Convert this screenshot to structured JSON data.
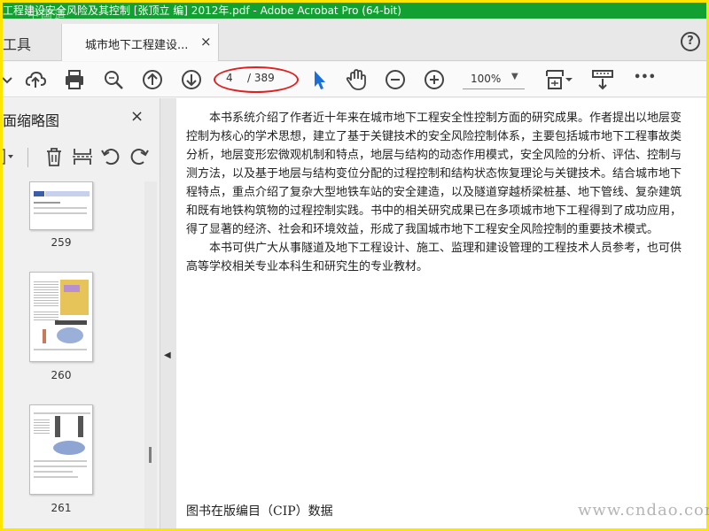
{
  "window": {
    "title": "工程建设安全风险及其控制 [张顶立 编] 2012年.pdf - Adobe Acrobat Pro (64-bit)",
    "watermark_top": "中国道"
  },
  "tabs": {
    "tools_label": "工具",
    "doc_label": "城市地下工程建设...",
    "close_glyph": "×"
  },
  "help": {
    "glyph": "?"
  },
  "toolbar": {
    "current_page": "4",
    "total_pages": "/ 389",
    "zoom": "100%",
    "more": "•••"
  },
  "sidebar": {
    "title": "面缩略图",
    "close_glyph": "×",
    "thumbnails": [
      {
        "page": "259"
      },
      {
        "page": "260"
      },
      {
        "page": "261"
      }
    ]
  },
  "document": {
    "paragraphs": [
      "　　本书系统介绍了作者近十年来在城市地下工程安全性控制方面的研究成果。作者提出以地层变",
      "控制为核心的学术思想，建立了基于关键技术的安全风险控制体系，主要包括城市地下工程事故类",
      "分析，地层变形宏微观机制和特点，地层与结构的动态作用模式，安全风险的分析、评估、控制与",
      "测方法，以及基于地层与结构变位分配的过程控制和结构状态恢复理论与关键技术。结合城市地下",
      "程特点，重点介绍了复杂大型地铁车站的安全建造，以及隧道穿越桥梁桩基、地下管线、复杂建筑",
      "和既有地铁构筑物的过程控制实践。书中的相关研究成果已在多项城市地下工程得到了成功应用，",
      "得了显著的经济、社会和环境效益，形成了我国城市地下工程安全风险控制的重要技术模式。",
      "　　本书可供广大从事隧道及地下工程设计、施工、监理和建设管理的工程技术人员参考，也可供",
      "高等学校相关专业本科生和研究生的专业教材。"
    ],
    "cip_heading": "图书在版编目（CIP）数据"
  },
  "watermark_bottom": "www.cndao.com",
  "colors": {
    "title_bar": "#13a033",
    "outer_border": "#ffe600",
    "highlight_circle": "#e02020",
    "cursor_arrow": "#1c6fd6"
  },
  "icons": [
    "cloud-upload-icon",
    "print-icon",
    "zoom-search-icon",
    "page-up-icon",
    "page-down-icon",
    "select-cursor-icon",
    "hand-tool-icon",
    "zoom-out-icon",
    "zoom-in-icon",
    "fit-page-icon",
    "scroll-mode-icon",
    "more-icon",
    "dropdown-caret-icon",
    "trash-icon",
    "extract-icon",
    "undo-icon",
    "redo-icon"
  ]
}
